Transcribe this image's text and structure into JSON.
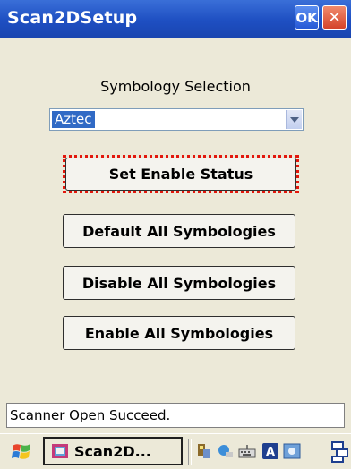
{
  "window": {
    "title": "Scan2DSetup",
    "ok_label": "OK",
    "close_label": "✕"
  },
  "main": {
    "symbology_label": "Symbology Selection",
    "symbology_selected": "Aztec",
    "buttons": {
      "set_enable": "Set Enable Status",
      "default_all": "Default All Symbologies",
      "disable_all": "Disable All Symbologies",
      "enable_all": "Enable All Symbologies"
    }
  },
  "status": {
    "text": "Scanner Open Succeed."
  },
  "taskbar": {
    "task_label": "Scan2D...",
    "icons": [
      "windows-start-icon",
      "scanner-app-icon",
      "network-icon",
      "keyboard-icon",
      "input-a-icon",
      "connectivity-icon",
      "desktop-toggle-icon"
    ]
  },
  "colors": {
    "titlebar": "#1E4FC2",
    "highlight_border": "#E2170C",
    "selection": "#316AC5",
    "close_button": "#D4432A"
  }
}
